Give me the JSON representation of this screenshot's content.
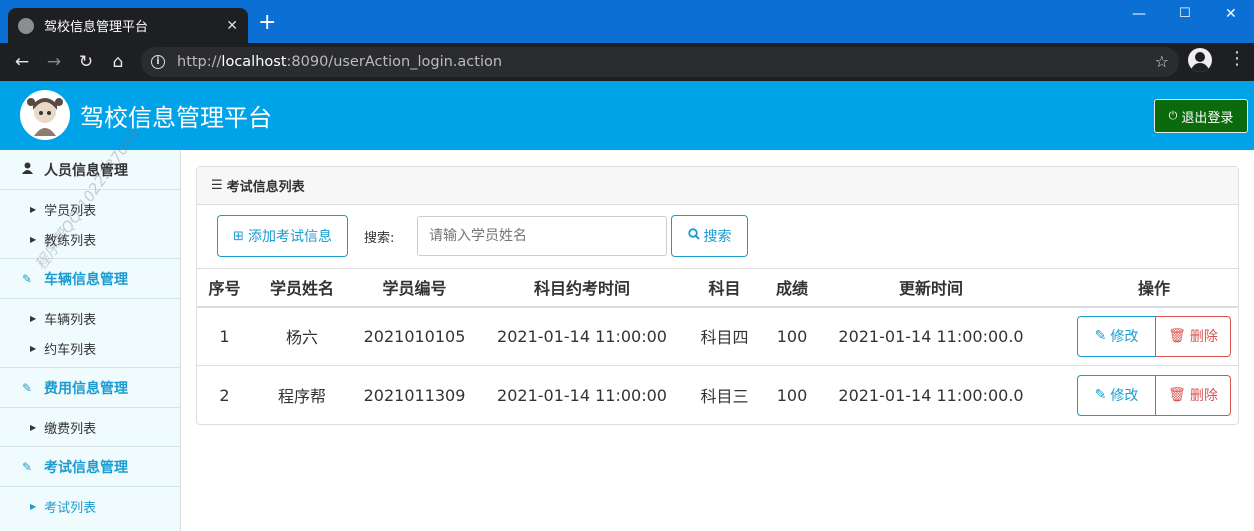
{
  "browser": {
    "tab_title": "驾校信息管理平台",
    "new_tab": "+",
    "url_host": "localhost",
    "url_prefix": "http://",
    "url_rest": ":8090/userAction_login.action"
  },
  "app": {
    "title": "驾校信息管理平台",
    "logout_label": "退出登录"
  },
  "sidebar": {
    "groups": [
      {
        "label": "人员信息管理",
        "items": [
          "学员列表",
          "教练列表"
        ]
      },
      {
        "label": "车辆信息管理",
        "items": [
          "车辆列表",
          "约车列表"
        ]
      },
      {
        "label": "费用信息管理",
        "items": [
          "缴费列表"
        ]
      },
      {
        "label": "考试信息管理",
        "items": [
          "考试列表"
        ]
      }
    ]
  },
  "watermark": "程序帮QQ:1022287044",
  "panel": {
    "heading": "考试信息列表",
    "add_label": "添加考试信息",
    "search_label": "搜索:",
    "search_placeholder": "请输入学员姓名",
    "search_button": "搜索"
  },
  "table": {
    "headers": [
      "序号",
      "学员姓名",
      "学员编号",
      "科目约考时间",
      "科目",
      "成绩",
      "更新时间",
      "操作"
    ],
    "rows": [
      [
        "1",
        "杨六",
        "2021010105",
        "2021-01-14 11:00:00",
        "科目四",
        "100",
        "2021-01-14 11:00:00.0"
      ],
      [
        "2",
        "程序帮",
        "2021011309",
        "2021-01-14 11:00:00",
        "科目三",
        "100",
        "2021-01-14 11:00:00.0"
      ]
    ],
    "edit_label": "修改",
    "delete_label": "删除"
  },
  "colors": {
    "header_bg": "#00a2e8",
    "accent": "#1a9cd2",
    "danger": "#d9534f",
    "logout_bg": "#0b6a0b"
  }
}
